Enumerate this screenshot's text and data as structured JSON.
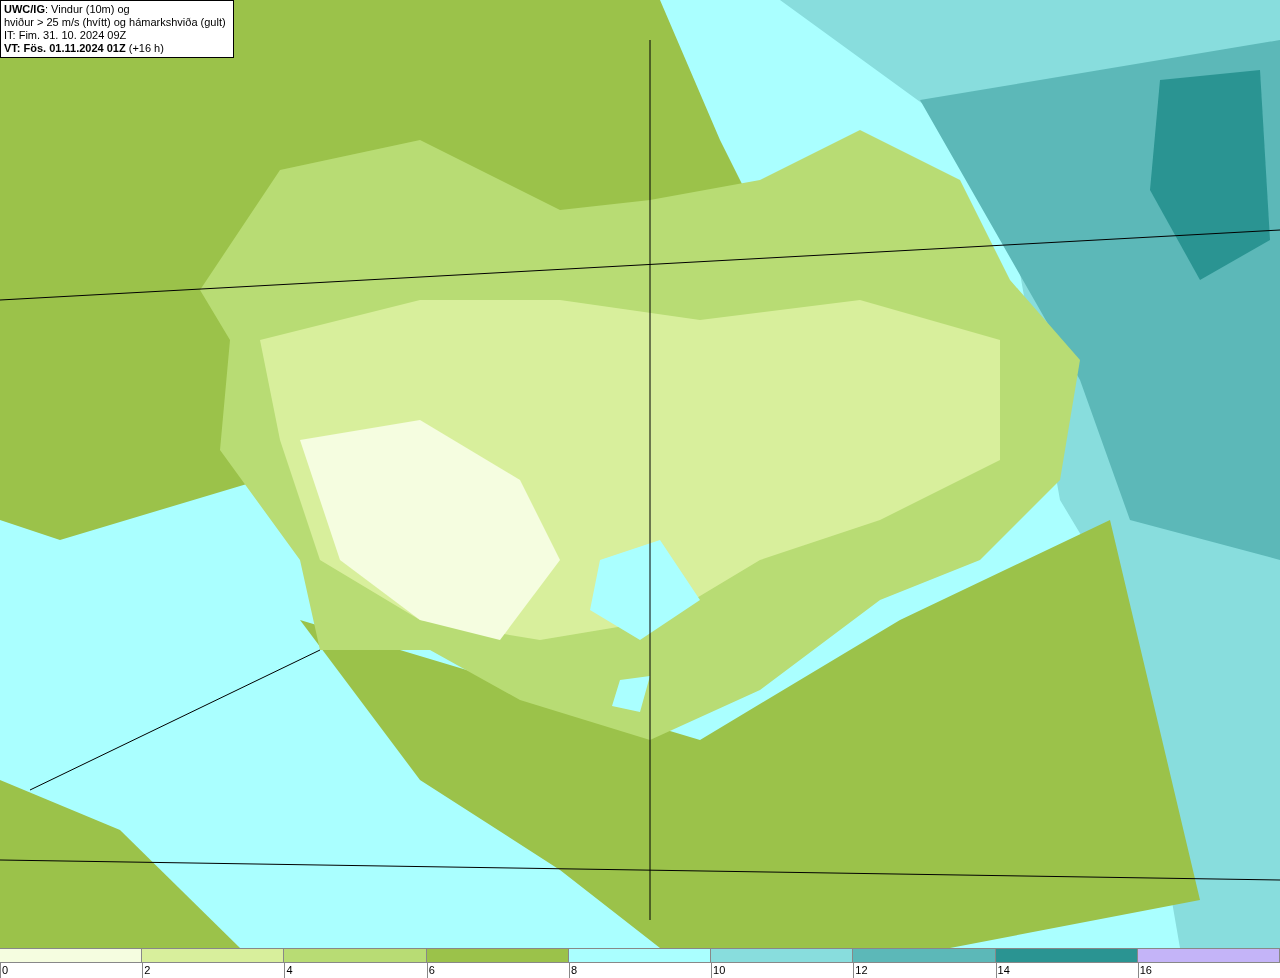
{
  "title_box": {
    "lines": [
      "**UWC/IG**: Vindur (10m) og",
      "hviður > 25 m/s (hvítt) og hámarkshviða (gult)",
      "IT: Fim. 31. 10. 2024 09Z",
      "**VT: Fös. 01.11.2024 01Z** (+16 h)"
    ]
  },
  "legend": {
    "bins": [
      {
        "color": "#f5fde0",
        "label": "0"
      },
      {
        "color": "#d8ef9c",
        "label": "2"
      },
      {
        "color": "#b8dc74",
        "label": "4"
      },
      {
        "color": "#9bc24a",
        "label": "6"
      },
      {
        "color": "#aaffff",
        "label": "8"
      },
      {
        "color": "#88dddd",
        "label": "10"
      },
      {
        "color": "#5cb8b8",
        "label": "12"
      },
      {
        "color": "#2a9492",
        "label": "14"
      },
      {
        "color": "#c4b4f8",
        "label": "16"
      }
    ]
  }
}
